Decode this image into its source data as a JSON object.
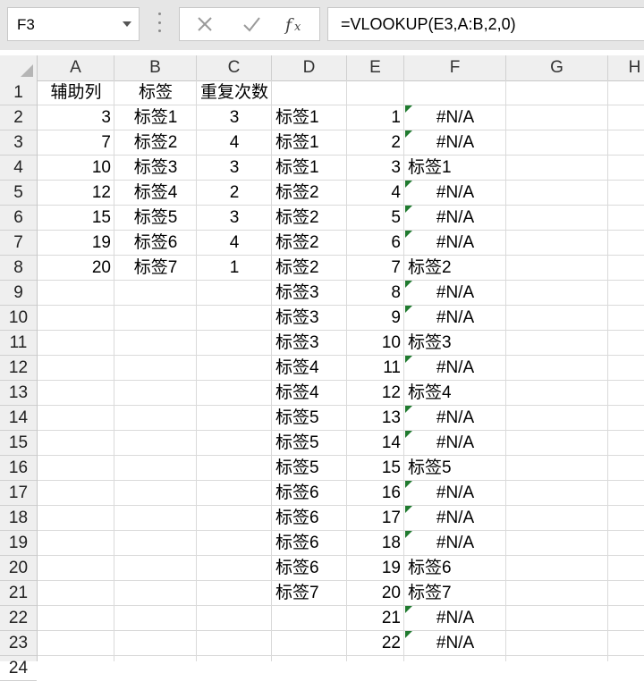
{
  "formula_bar": {
    "name_box": "F3",
    "formula": "=VLOOKUP(E3,A:B,2,0)",
    "cancel_icon": "x-icon",
    "enter_icon": "check-icon",
    "function_icon": "fx-icon"
  },
  "columns": [
    "A",
    "B",
    "C",
    "D",
    "E",
    "F",
    "G",
    "H"
  ],
  "rows": [
    "1",
    "2",
    "3",
    "4",
    "5",
    "6",
    "7",
    "8",
    "9",
    "10",
    "11",
    "12",
    "13",
    "14",
    "15",
    "16",
    "17",
    "18",
    "19",
    "20",
    "21",
    "22",
    "23",
    "24"
  ],
  "header_row": {
    "A": "辅助列",
    "B": "标签",
    "C": "重复次数"
  },
  "col_a": [
    "3",
    "7",
    "10",
    "12",
    "15",
    "19",
    "20"
  ],
  "col_b": [
    "标签1",
    "标签2",
    "标签3",
    "标签4",
    "标签5",
    "标签6",
    "标签7"
  ],
  "col_c": [
    "3",
    "4",
    "3",
    "2",
    "3",
    "4",
    "1"
  ],
  "col_d": [
    "标签1",
    "标签1",
    "标签1",
    "标签2",
    "标签2",
    "标签2",
    "标签2",
    "标签3",
    "标签3",
    "标签3",
    "标签4",
    "标签4",
    "标签5",
    "标签5",
    "标签5",
    "标签6",
    "标签6",
    "标签6",
    "标签6",
    "标签7"
  ],
  "col_e": [
    "1",
    "2",
    "3",
    "4",
    "5",
    "6",
    "7",
    "8",
    "9",
    "10",
    "11",
    "12",
    "13",
    "14",
    "15",
    "16",
    "17",
    "18",
    "19",
    "20",
    "21",
    "22"
  ],
  "col_f": [
    "#N/A",
    "#N/A",
    "标签1",
    "#N/A",
    "#N/A",
    "#N/A",
    "标签2",
    "#N/A",
    "#N/A",
    "标签3",
    "#N/A",
    "标签4",
    "#N/A",
    "#N/A",
    "标签5",
    "#N/A",
    "#N/A",
    "#N/A",
    "标签6",
    "标签7",
    "#N/A",
    "#N/A"
  ],
  "colors": {
    "error_indicator": "#1f7a2e",
    "gridline": "#dadada",
    "header_bg": "#efefef"
  }
}
